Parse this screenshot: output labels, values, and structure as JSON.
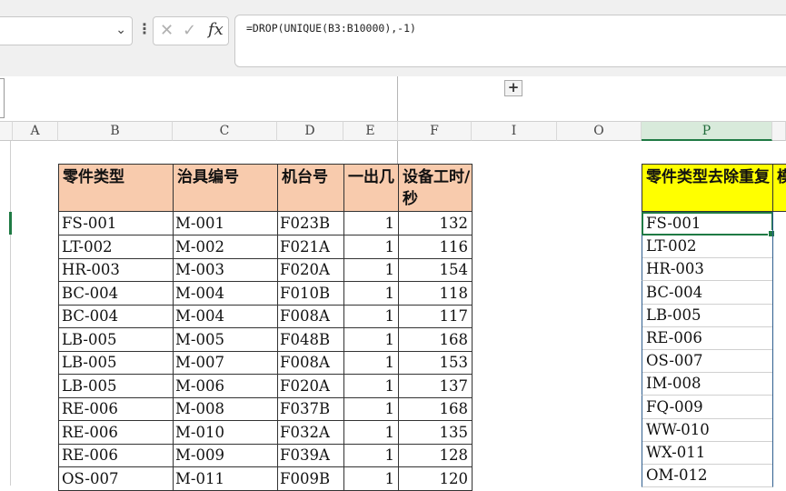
{
  "toolbar": {
    "name_box_value": "",
    "more_icon": "⋮",
    "cancel_icon": "✕",
    "enter_icon": "✓",
    "fx_label": "fx",
    "formula": "=DROP(UNIQUE(B3:B10000),-1)",
    "expand_icon": "+"
  },
  "columns": [
    "A",
    "B",
    "C",
    "D",
    "E",
    "F",
    "I",
    "O",
    "P"
  ],
  "table1": {
    "headers": [
      "零件类型",
      "治具编号",
      "机台号",
      "一出几",
      "设备工时/秒"
    ],
    "rows": [
      [
        "FS-001",
        "M-001",
        "F023B",
        "1",
        "132"
      ],
      [
        "LT-002",
        "M-002",
        "F021A",
        "1",
        "116"
      ],
      [
        "HR-003",
        "M-003",
        "F020A",
        "1",
        "154"
      ],
      [
        "BC-004",
        "M-004",
        "F010B",
        "1",
        "118"
      ],
      [
        "BC-004",
        "M-004",
        "F008A",
        "1",
        "117"
      ],
      [
        "LB-005",
        "M-005",
        "F048B",
        "1",
        "168"
      ],
      [
        "LB-005",
        "M-007",
        "F008A",
        "1",
        "153"
      ],
      [
        "LB-005",
        "M-006",
        "F020A",
        "1",
        "137"
      ],
      [
        "RE-006",
        "M-008",
        "F037B",
        "1",
        "168"
      ],
      [
        "RE-006",
        "M-010",
        "F032A",
        "1",
        "135"
      ],
      [
        "RE-006",
        "M-009",
        "F039A",
        "1",
        "128"
      ],
      [
        "OS-007",
        "M-011",
        "F009B",
        "1",
        "120"
      ]
    ]
  },
  "table2": {
    "header": "零件类型去除重复",
    "next_header_partial": "模",
    "values": [
      "FS-001",
      "LT-002",
      "HR-003",
      "BC-004",
      "LB-005",
      "RE-006",
      "OS-007",
      "IM-008",
      "FQ-009",
      "WW-010",
      "WX-011",
      "OM-012"
    ]
  },
  "colors": {
    "header_fill": "#f8cbad",
    "unique_header_fill": "#ffff00",
    "selection": "#1f7a44"
  }
}
